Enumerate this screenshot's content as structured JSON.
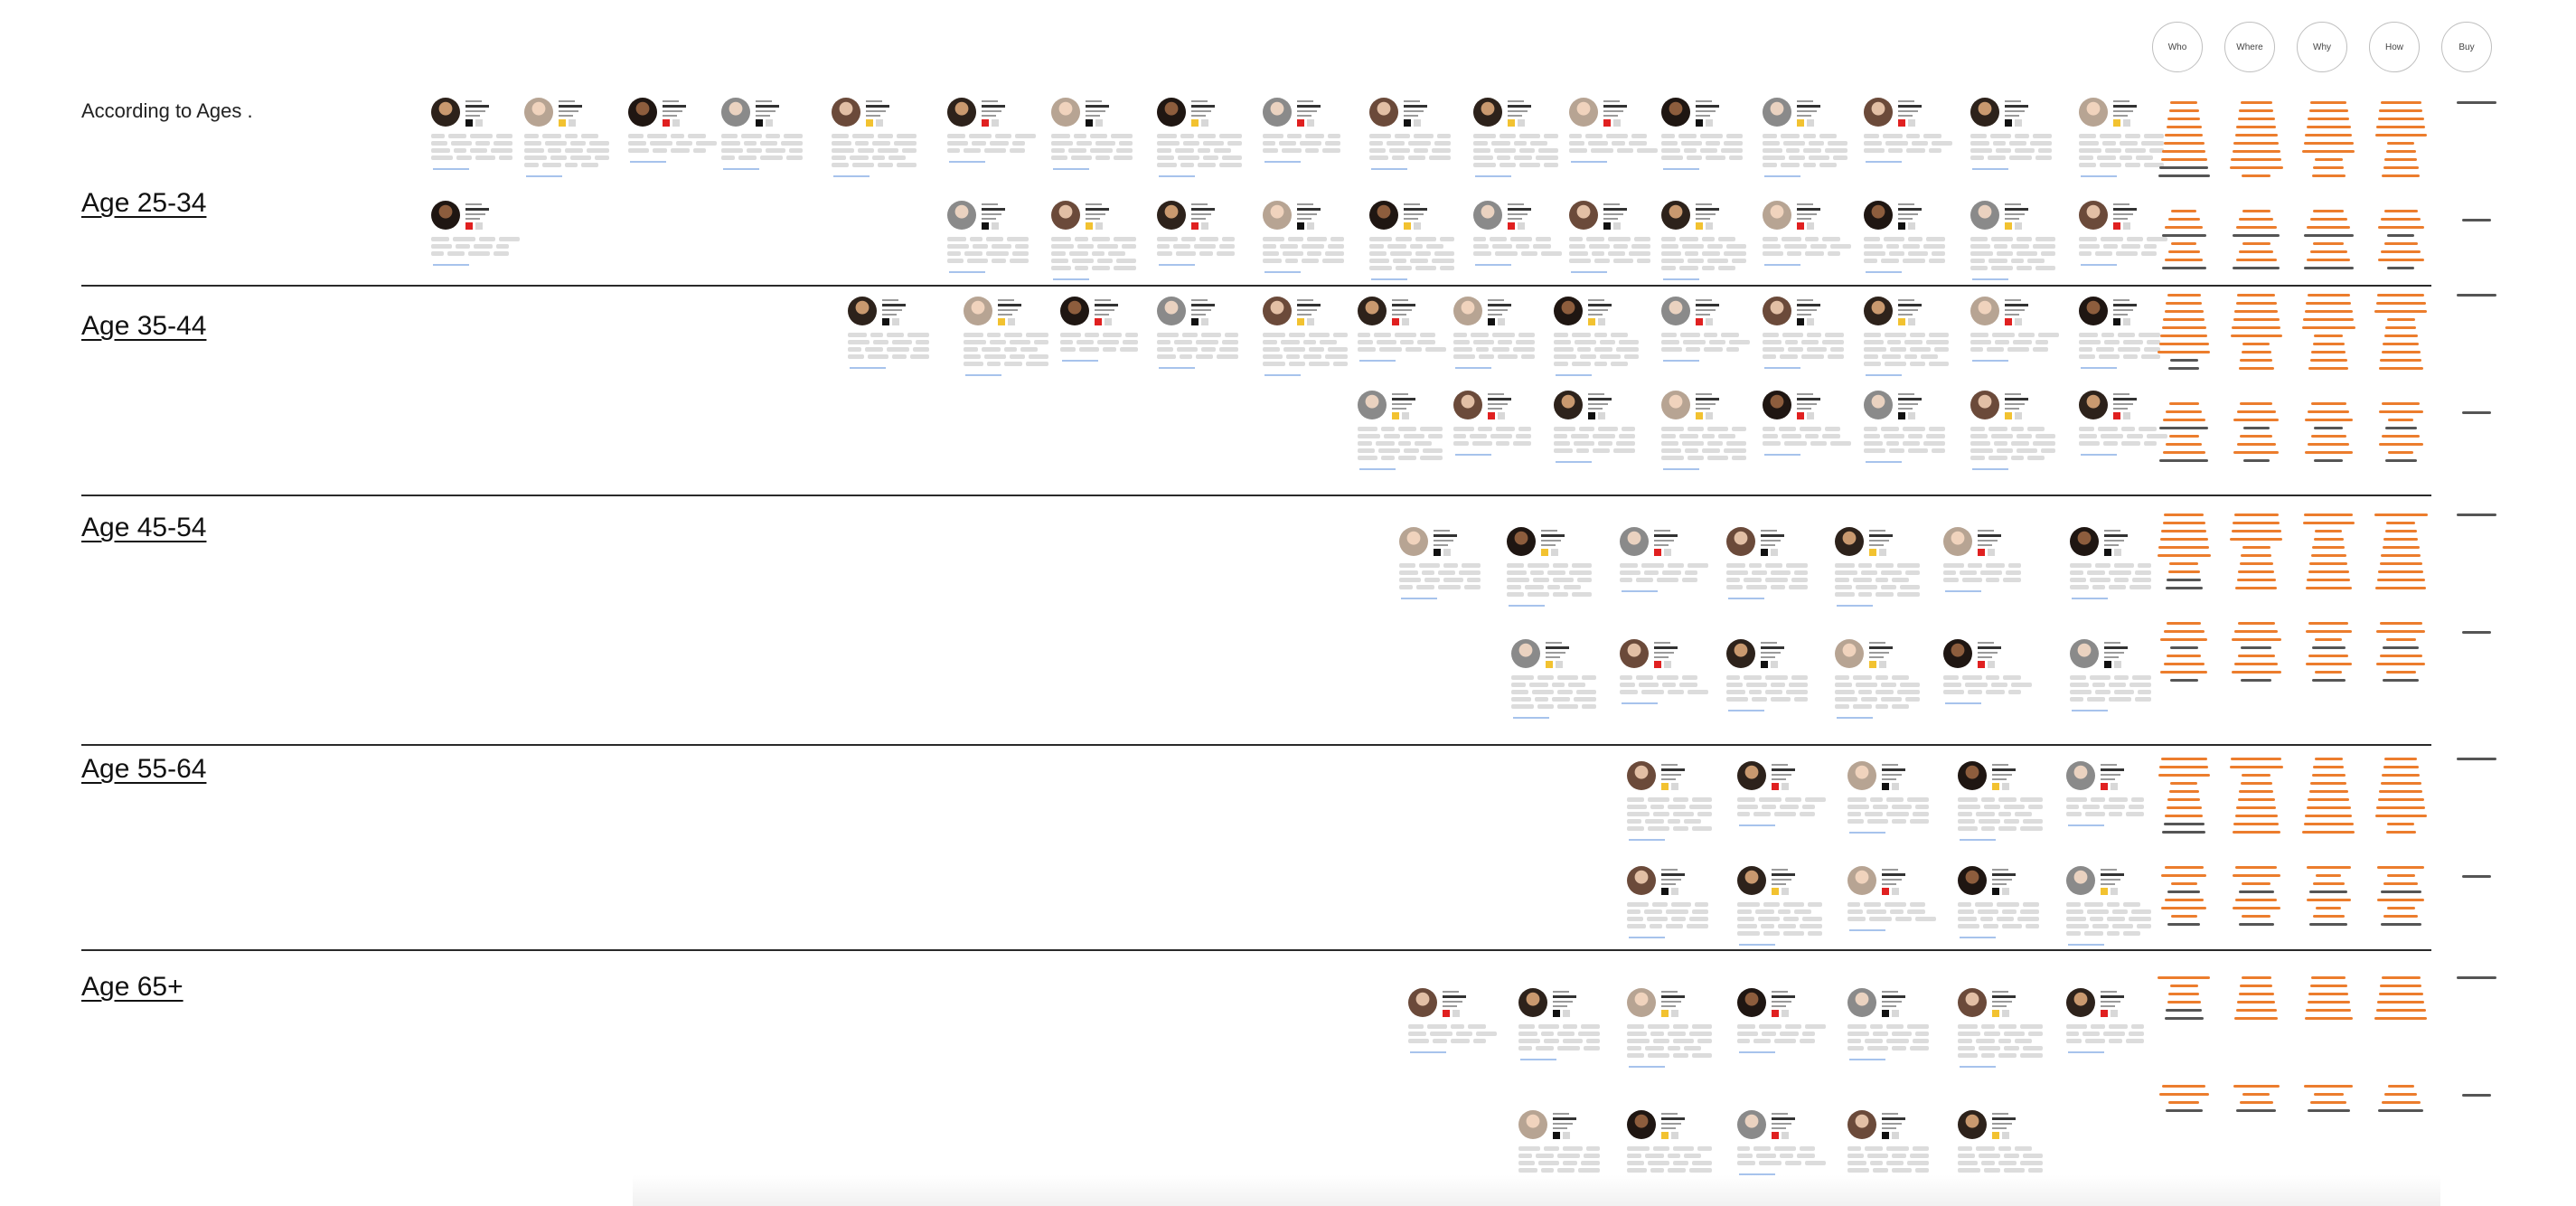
{
  "page_title": "According to Ages .",
  "columns": [
    "Who",
    "Where",
    "Why",
    "How",
    "Buy"
  ],
  "age_groups": [
    {
      "label": "Age 25-34"
    },
    {
      "label": "Age 35-44"
    },
    {
      "label": "Age 45-54"
    },
    {
      "label": "Age 55-64"
    },
    {
      "label": "Age 65+"
    }
  ],
  "colors": {
    "note_orange": "#ec7d2d",
    "link_blue": "#a7c3ec",
    "divider": "#2a2a2a",
    "badge_red": "#e02020",
    "badge_yellow": "#f2c230"
  },
  "icons": [
    "avatar-photo",
    "flag-badge"
  ]
}
